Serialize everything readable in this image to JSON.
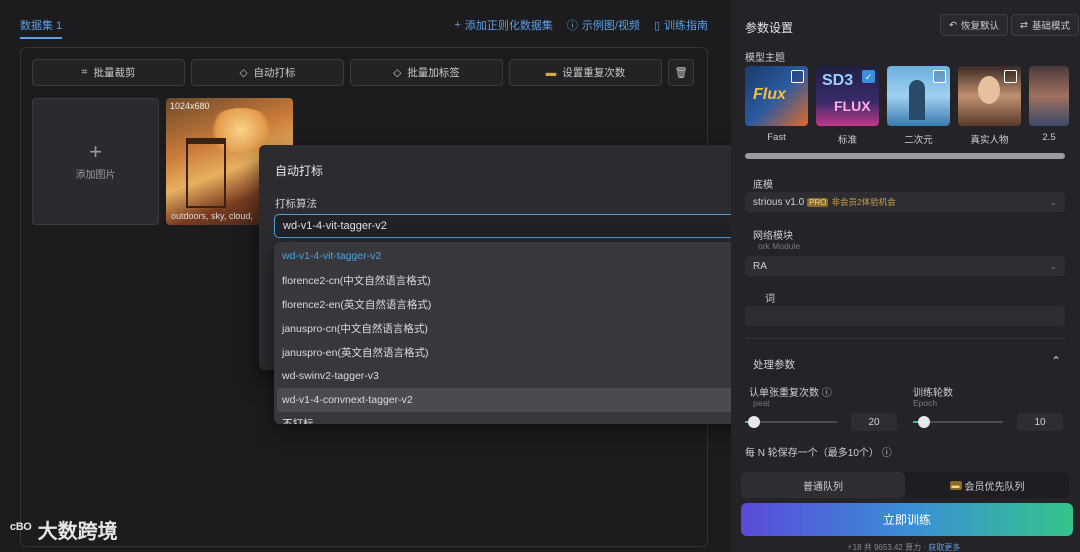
{
  "left": {
    "dataset_tab": "数据集 1",
    "links": [
      "添加正则化数据集",
      "示例图/视频",
      "训练指南"
    ],
    "toolbar": [
      "批量裁剪",
      "自动打标",
      "批量加标签",
      "设置重复次数"
    ],
    "add_image": "添加图片",
    "thumb": {
      "size": "1024x680",
      "caption": "outdoors, sky, cloud,"
    },
    "brand": "大数跨境"
  },
  "dialog": {
    "title": "自动打标",
    "label": "打标算法",
    "selected": "wd-v1-4-vit-tagger-v2",
    "options": [
      "wd-v1-4-vit-tagger-v2",
      "florence2-cn(中文自然语言格式)",
      "florence2-en(英文自然语言格式)",
      "januspro-cn(中文自然语言格式)",
      "januspro-en(英文自然语言格式)",
      "wd-swinv2-tagger-v3",
      "wd-v1-4-convnext-tagger-v2",
      "不打标"
    ]
  },
  "right": {
    "title": "参数设置",
    "reset": "恢复默认",
    "mode": "基础模式",
    "theme_label": "模型主题",
    "themes": [
      {
        "label": "Fast",
        "checked": false
      },
      {
        "label": "标准",
        "checked": true
      },
      {
        "label": "二次元",
        "checked": false
      },
      {
        "label": "真实人物",
        "checked": false
      },
      {
        "label": "2.5",
        "checked": false
      }
    ],
    "base_label": "底模",
    "base_value": "strious v1.0",
    "pro": "PRO",
    "base_note": "非会员2体验机会",
    "network_label": "网络模块",
    "network_en": "ork Module",
    "network_value": "RA",
    "trigger_label": "词",
    "section": "处理参数",
    "repeat_label": "认单张重复次数",
    "repeat_en": "peat",
    "repeat_value": "20",
    "repeat_fraction": 0.1,
    "epoch_label": "训练轮数",
    "epoch_en": "Epoch",
    "epoch_value": "10",
    "epoch_fraction": 0.12,
    "save_every": "每 N 轮保存一个（最多10个）",
    "queue_normal": "普通队列",
    "queue_vip": "会员优先队列",
    "start": "立即训练",
    "credits": "⚡18 共 9653.42 算力 · ",
    "credits_link": "获取更多"
  }
}
